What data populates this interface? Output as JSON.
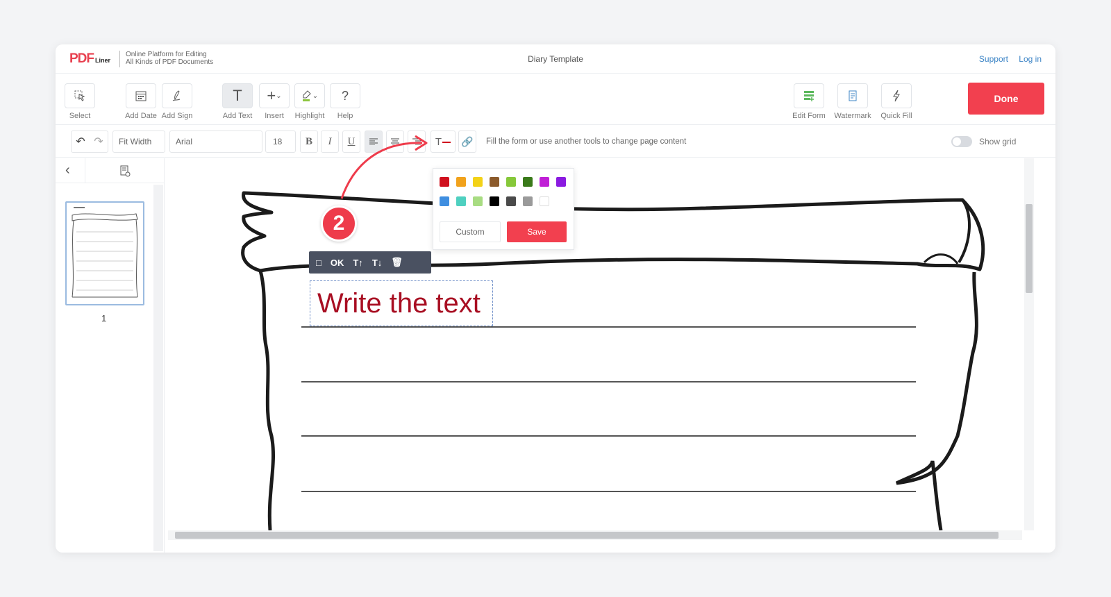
{
  "header": {
    "logo_text": "PDF",
    "logo_sub": "Liner",
    "tagline_line1": "Online Platform for Editing",
    "tagline_line2": "All Kinds of PDF Documents",
    "doc_title": "Diary Template",
    "support_link": "Support",
    "login_link": "Log in"
  },
  "toolbar": {
    "select": "Select",
    "add_date": "Add Date",
    "add_sign": "Add Sign",
    "add_text": "Add Text",
    "insert": "Insert",
    "highlight": "Highlight",
    "help": "Help",
    "edit_form": "Edit Form",
    "watermark": "Watermark",
    "quick_fill": "Quick Fill",
    "done": "Done"
  },
  "format_bar": {
    "zoom": "Fit Width",
    "font": "Arial",
    "size": "18",
    "bold": "B",
    "italic": "I",
    "underline": "U",
    "hint": "Fill the form or use another tools to change page content",
    "show_grid": "Show grid"
  },
  "sidebar": {
    "page_number": "1"
  },
  "text_toolbar": {
    "ok": "OK"
  },
  "text_box": {
    "content": "Write the text"
  },
  "color_popup": {
    "colors": [
      "#d0101e",
      "#f1a21c",
      "#f3d218",
      "#8b5a2b",
      "#86c83a",
      "#3a7a1a",
      "#c01fd6",
      "#8a1be0",
      "#3f8ee0",
      "#4fd0c0",
      "#a8dc82",
      "#000000",
      "#4a4a4a",
      "#9a9a9a",
      "#ffffff"
    ],
    "custom_label": "Custom",
    "save_label": "Save"
  },
  "step_badge": "2",
  "accent_color": "#f2404f"
}
